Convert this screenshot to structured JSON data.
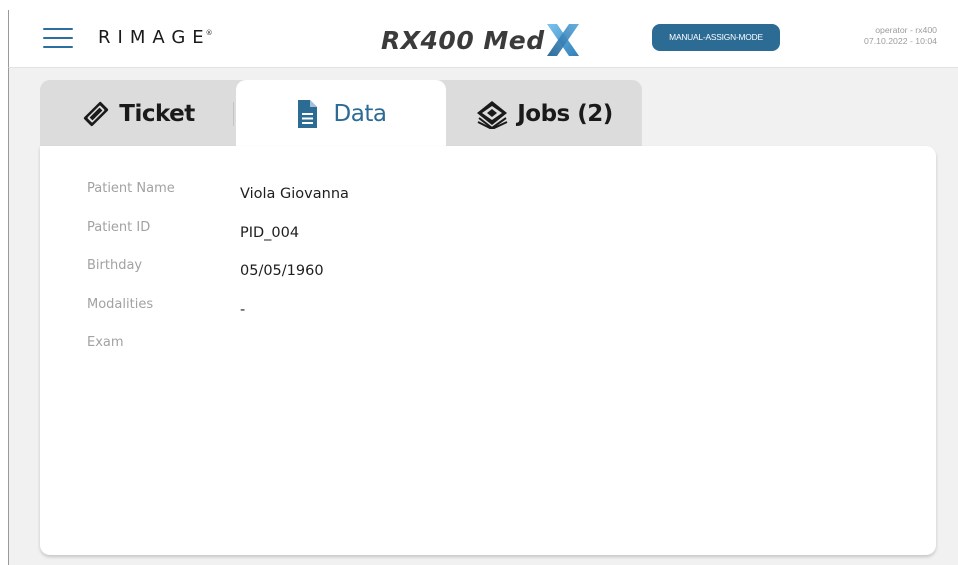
{
  "header": {
    "brand": "RIMAGE",
    "brand_mark": "®",
    "product_name": "RX400 Med",
    "mode_badge": "MANUAL-ASSIGN-MODE",
    "user": "operator - rx400",
    "datetime": "07.10.2022 - 10:04"
  },
  "tabs": [
    {
      "label": "Ticket",
      "icon": "ticket-icon",
      "active": false
    },
    {
      "label": "Data",
      "icon": "document-icon",
      "active": true
    },
    {
      "label": "Jobs (2)",
      "icon": "discs-icon",
      "active": false
    }
  ],
  "patient": {
    "rows": [
      {
        "label": "Patient Name",
        "value": "Viola Giovanna"
      },
      {
        "label": "Patient ID",
        "value": "PID_004"
      },
      {
        "label": "Birthday",
        "value": "05/05/1960"
      },
      {
        "label": "Modalities",
        "value": "-"
      },
      {
        "label": "Exam",
        "value": ""
      }
    ]
  },
  "colors": {
    "accent": "#2c6b94",
    "tab_bar": "#dcdcdc",
    "background": "#f1f1f1"
  }
}
